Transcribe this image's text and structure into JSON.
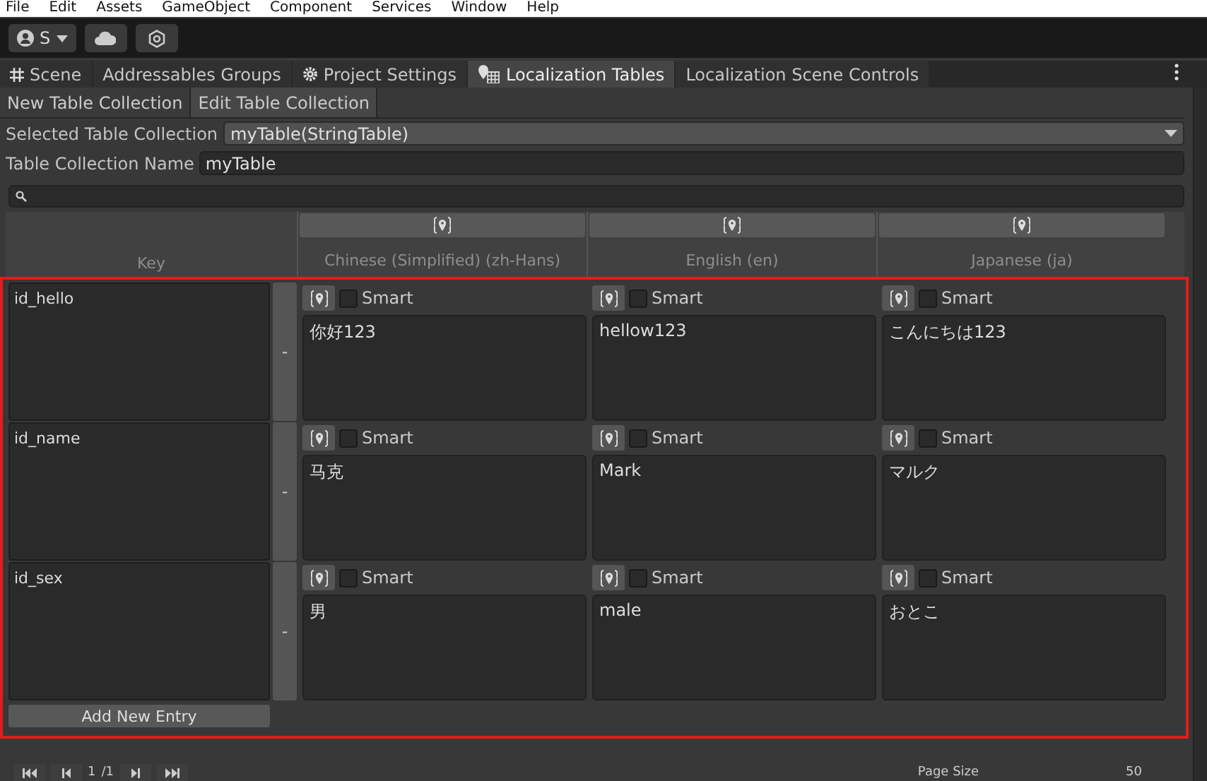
{
  "menu": [
    "File",
    "Edit",
    "Assets",
    "GameObject",
    "Component",
    "Services",
    "Window",
    "Help"
  ],
  "toolbar": {
    "account": "S"
  },
  "tabs": [
    {
      "label": "Scene",
      "kind": "scene",
      "selected": false
    },
    {
      "label": "Addressables Groups",
      "kind": "plain",
      "selected": false
    },
    {
      "label": "Project Settings",
      "kind": "settings",
      "selected": false
    },
    {
      "label": "Localization Tables",
      "kind": "localization",
      "selected": true
    },
    {
      "label": "Localization Scene Controls",
      "kind": "plain",
      "selected": false
    }
  ],
  "subtabs": [
    {
      "label": "New Table Collection",
      "selected": false
    },
    {
      "label": "Edit Table Collection",
      "selected": true
    }
  ],
  "selected_collection": {
    "label": "Selected Table Collection",
    "value": "myTable(StringTable)"
  },
  "collection_name": {
    "label": "Table Collection Name",
    "value": "myTable"
  },
  "table": {
    "key_header": "Key",
    "languages": [
      "Chinese (Simplified) (zh-Hans)",
      "English (en)",
      "Japanese (ja)"
    ],
    "rows": [
      {
        "key": "id_hello",
        "remove": "-",
        "values": [
          {
            "text": "你好123",
            "smart_label": "Smart",
            "smart": false
          },
          {
            "text": "hellow123",
            "smart_label": "Smart",
            "smart": false
          },
          {
            "text": "こんにちは123",
            "smart_label": "Smart",
            "smart": false
          }
        ]
      },
      {
        "key": "id_name",
        "remove": "-",
        "values": [
          {
            "text": "马克",
            "smart_label": "Smart",
            "smart": false
          },
          {
            "text": "Mark",
            "smart_label": "Smart",
            "smart": false
          },
          {
            "text": "マルク",
            "smart_label": "Smart",
            "smart": false
          }
        ]
      },
      {
        "key": "id_sex",
        "remove": "-",
        "values": [
          {
            "text": "男",
            "smart_label": "Smart",
            "smart": false
          },
          {
            "text": "male",
            "smart_label": "Smart",
            "smart": false
          },
          {
            "text": "おとこ",
            "smart_label": "Smart",
            "smart": false
          }
        ]
      }
    ],
    "add_button": "Add New Entry"
  },
  "pager": {
    "page": "1",
    "total": "/1",
    "page_size_label": "Page Size",
    "page_size": "50"
  }
}
